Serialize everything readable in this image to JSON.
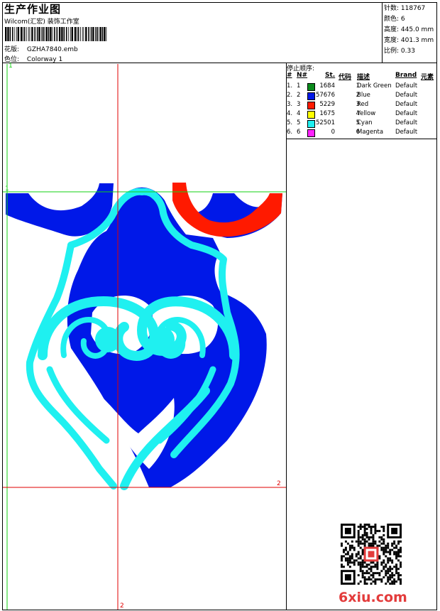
{
  "header": {
    "title": "生产作业图",
    "company": "Wilcom(汇宏) 装饰工作室",
    "file_label": "花版:",
    "file_value": "GZHA7840.emb",
    "color_label": "色位:",
    "color_value": "Colorway 1"
  },
  "stats": {
    "stitches_label": "针数:",
    "stitches_value": "118767",
    "colors_label": "颜色:",
    "colors_value": "6",
    "height_label": "高度:",
    "height_value": "445.0 mm",
    "width_label": "宽度:",
    "width_value": "401.3 mm",
    "scale_label": "比例:",
    "scale_value": "0.33"
  },
  "stop_sequence": {
    "heading": "停止顺序:",
    "columns": [
      "#",
      "N#",
      "St.",
      "代码",
      "描述",
      "Brand",
      "元素"
    ],
    "rows": [
      {
        "idx": "1.",
        "n": "1",
        "color": "#0a8a1c",
        "st": "1684",
        "code": "1",
        "desc": "Dark Green",
        "brand": "Default"
      },
      {
        "idx": "2.",
        "n": "2",
        "color": "#0018e8",
        "st": "57676",
        "code": "2",
        "desc": "Blue",
        "brand": "Default"
      },
      {
        "idx": "3.",
        "n": "3",
        "color": "#ff1a00",
        "st": "5229",
        "code": "3",
        "desc": "Red",
        "brand": "Default"
      },
      {
        "idx": "4.",
        "n": "4",
        "color": "#ffff00",
        "st": "1675",
        "code": "4",
        "desc": "Yellow",
        "brand": "Default"
      },
      {
        "idx": "5.",
        "n": "5",
        "color": "#1ff0f0",
        "st": "52501",
        "code": "5",
        "desc": "Cyan",
        "brand": "Default"
      },
      {
        "idx": "6.",
        "n": "6",
        "color": "#ff22ff",
        "st": "0",
        "code": "6",
        "desc": "Magenta",
        "brand": "Default"
      }
    ]
  },
  "canvas_markers": {
    "green_top": "1",
    "green_left": "1",
    "red_right": "2",
    "red_bottom": "2"
  },
  "watermark": "6xiu.com"
}
